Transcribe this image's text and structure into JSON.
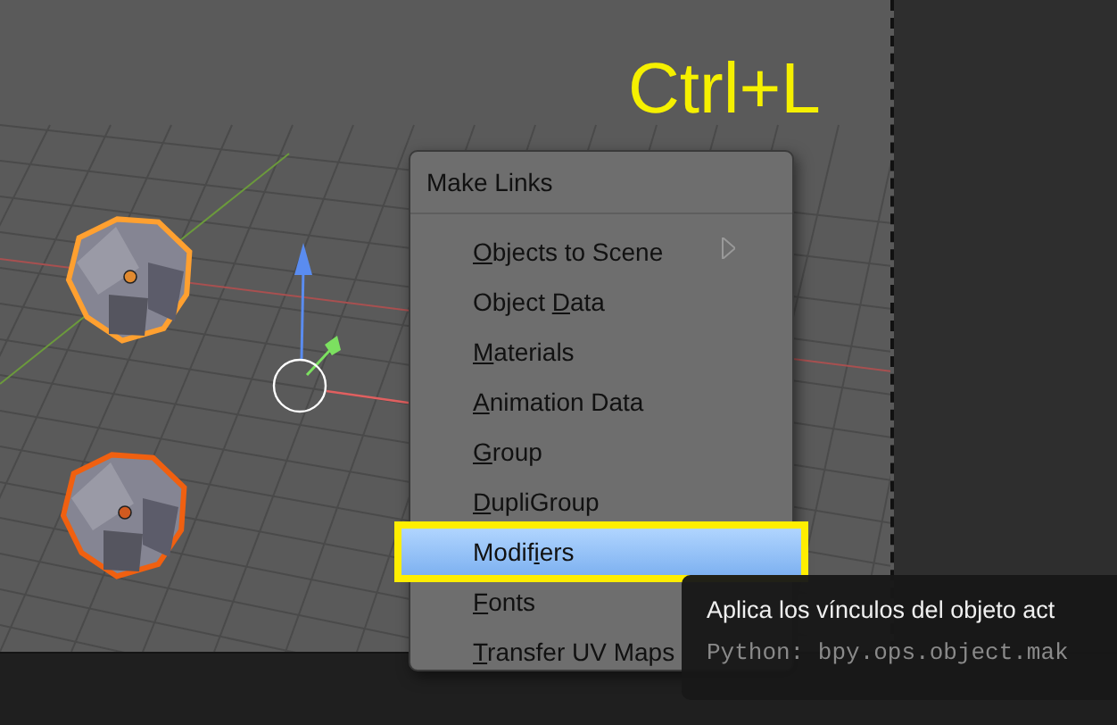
{
  "viewport": {
    "objects": [
      {
        "active": true
      },
      {
        "active": false
      }
    ]
  },
  "shortcut_label": "Ctrl+L",
  "menu": {
    "title": "Make Links",
    "items": [
      {
        "key": "O",
        "post": "bjects to Scene",
        "submenu": true,
        "selected": false
      },
      {
        "pre": "Object ",
        "key": "D",
        "post": "ata",
        "submenu": false,
        "selected": false
      },
      {
        "key": "M",
        "post": "aterials",
        "submenu": false,
        "selected": false
      },
      {
        "key": "A",
        "post": "nimation Data",
        "submenu": false,
        "selected": false
      },
      {
        "key": "G",
        "post": "roup",
        "submenu": false,
        "selected": false
      },
      {
        "key": "D",
        "post": "upliGroup",
        "submenu": false,
        "selected": false
      },
      {
        "pre": "Modif",
        "key": "i",
        "post": "ers",
        "submenu": false,
        "selected": true
      },
      {
        "key": "F",
        "post": "onts",
        "submenu": false,
        "selected": false
      },
      {
        "key": "T",
        "post": "ransfer UV Maps",
        "submenu": false,
        "selected": false
      }
    ]
  },
  "tooltip": {
    "text": "Aplica los vínculos del objeto act",
    "python": "Python: bpy.ops.object.mak"
  }
}
